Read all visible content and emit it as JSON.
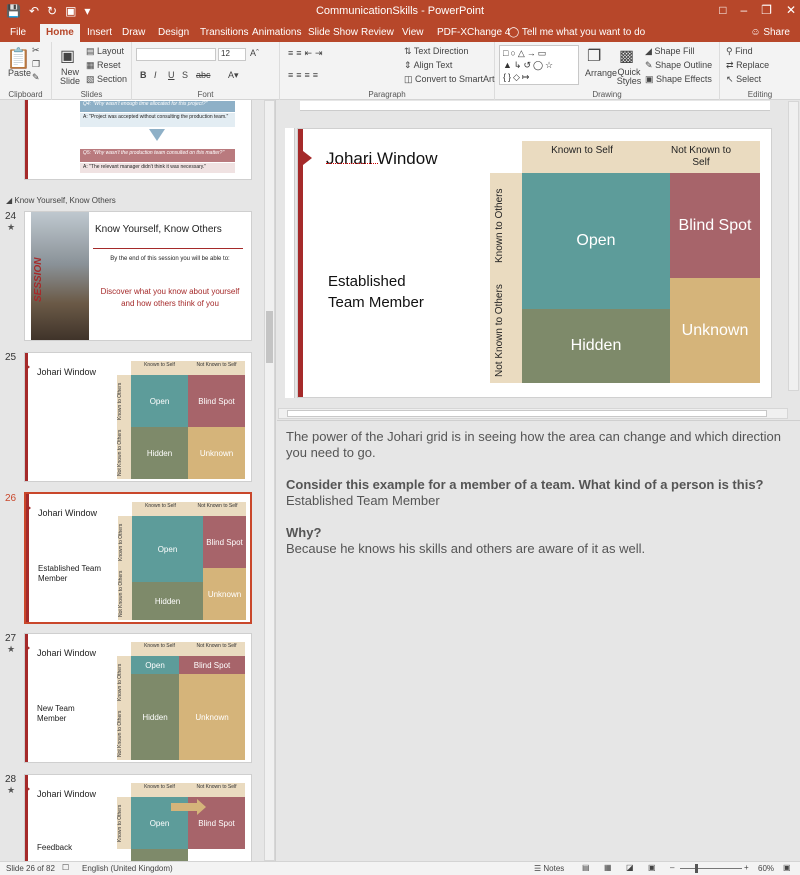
{
  "app": {
    "title": "CommunicationSkills - PowerPoint",
    "share": "Share",
    "tell_me": "Tell me what you want to do"
  },
  "tabs": [
    "File",
    "Home",
    "Insert",
    "Draw",
    "Design",
    "Transitions",
    "Animations",
    "Slide Show",
    "Review",
    "View",
    "PDF-XChange 4"
  ],
  "ribbon": {
    "clipboard": {
      "paste": "Paste",
      "label": "Clipboard"
    },
    "slides": {
      "new_slide": "New Slide",
      "layout": "Layout",
      "reset": "Reset",
      "section": "Section",
      "label": "Slides"
    },
    "font": {
      "size": "12",
      "label": "Font",
      "buttons": [
        "B",
        "I",
        "U",
        "S",
        "abc"
      ]
    },
    "paragraph": {
      "text_direction": "Text Direction",
      "align_text": "Align Text",
      "convert_smartart": "Convert to SmartArt",
      "label": "Paragraph"
    },
    "drawing": {
      "arrange": "Arrange",
      "quick_styles": "Quick Styles",
      "shape_fill": "Shape Fill",
      "shape_outline": "Shape Outline",
      "shape_effects": "Shape Effects",
      "label": "Drawing"
    },
    "editing": {
      "find": "Find",
      "replace": "Replace",
      "select": "Select",
      "label": "Editing"
    }
  },
  "thumbs": {
    "prev": {
      "q4": "Q4: \"Why wasn't enough time allocated for this project?\"",
      "a4": "A: \"Project was accepted without consulting the production team.\"",
      "q5": "Q5: \"Why wasn't the production team consulted on this matter?\"",
      "a5": "A: \"The relevant manager didn't think it was necessary.\""
    },
    "section": "Know Yourself, Know Others",
    "s24": {
      "num": "24",
      "title": "Know Yourself, Know Others",
      "banner": "SESSION",
      "intro": "By the end of this session you will be able to:",
      "bullet": "Discover what you know about yourself and how others think of you"
    },
    "s25": {
      "num": "25",
      "title": "Johari Window"
    },
    "s26": {
      "num": "26",
      "title": "Johari Window",
      "sub": "Established Team Member"
    },
    "s27": {
      "num": "27",
      "title": "Johari Window",
      "sub": "New Team Member"
    },
    "s28": {
      "num": "28",
      "title": "Johari Window",
      "sub": "Feedback"
    }
  },
  "johari": {
    "known_self": "Known to Self",
    "not_known_self": "Not Known to Self",
    "known_others": "Known to Others",
    "not_known_others": "Not Known to Others",
    "open": "Open",
    "blind": "Blind Spot",
    "hidden": "Hidden",
    "unknown": "Unknown"
  },
  "slide": {
    "title": "Johari Window",
    "subtitle_line1": "Established",
    "subtitle_line2": "Team Member"
  },
  "notes": {
    "p1": "The power of the Johari grid is in seeing how the area can change and which direction you need to go.",
    "q1": "Consider this example for a member of a team. What kind of a person is this?",
    "a1": "Established Team Member",
    "q2": "Why?",
    "a2": "Because he knows his skills and others are aware of it as well."
  },
  "status": {
    "slide_info": "Slide 26 of 82",
    "language": "English (United Kingdom)",
    "notes": "Notes",
    "zoom": "60%"
  }
}
